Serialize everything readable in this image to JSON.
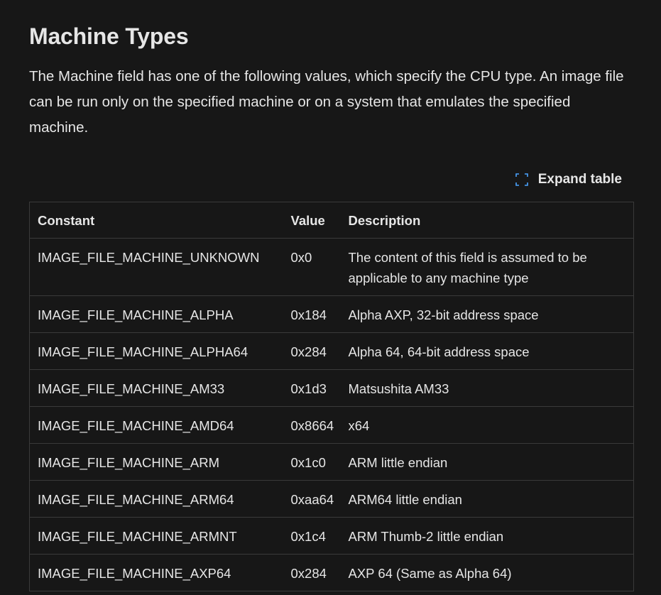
{
  "heading": "Machine Types",
  "intro": "The Machine field has one of the following values, which specify the CPU type. An image file can be run only on the specified machine or on a system that emulates the specified machine.",
  "expand": {
    "label": "Expand table",
    "icon": "expand-icon"
  },
  "colors": {
    "background": "#171717",
    "text": "#e6e6e6",
    "border": "#3a3a3a",
    "icon": "#4aa3ff"
  },
  "table": {
    "headers": [
      "Constant",
      "Value",
      "Description"
    ],
    "rows": [
      [
        "IMAGE_FILE_MACHINE_UNKNOWN",
        "0x0",
        "The content of this field is assumed to be applicable to any machine type"
      ],
      [
        "IMAGE_FILE_MACHINE_ALPHA",
        "0x184",
        "Alpha AXP, 32-bit address space"
      ],
      [
        "IMAGE_FILE_MACHINE_ALPHA64",
        "0x284",
        "Alpha 64, 64-bit address space"
      ],
      [
        "IMAGE_FILE_MACHINE_AM33",
        "0x1d3",
        "Matsushita AM33"
      ],
      [
        "IMAGE_FILE_MACHINE_AMD64",
        "0x8664",
        "x64"
      ],
      [
        "IMAGE_FILE_MACHINE_ARM",
        "0x1c0",
        "ARM little endian"
      ],
      [
        "IMAGE_FILE_MACHINE_ARM64",
        "0xaa64",
        "ARM64 little endian"
      ],
      [
        "IMAGE_FILE_MACHINE_ARMNT",
        "0x1c4",
        "ARM Thumb-2 little endian"
      ],
      [
        "IMAGE_FILE_MACHINE_AXP64",
        "0x284",
        "AXP 64 (Same as Alpha 64)"
      ]
    ]
  }
}
